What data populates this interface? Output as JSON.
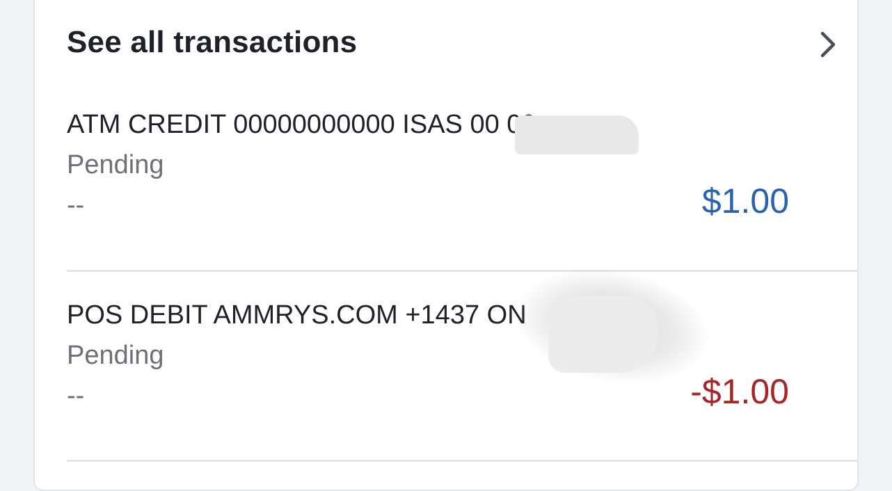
{
  "header": {
    "title": "See all transactions",
    "chevron_icon": "chevron-right-icon"
  },
  "transactions": [
    {
      "description": "ATM CREDIT 00000000000 ISAS 00 00",
      "status": "Pending",
      "date": "--",
      "amount": "$1.00",
      "amount_color": "#2a62b2"
    },
    {
      "description": "POS DEBIT AMMRYS.COM +1437 ON",
      "status": "Pending",
      "date": "--",
      "amount": "-$1.00",
      "amount_color": "#a82427"
    }
  ],
  "colors": {
    "background": "#f2f3f5",
    "card": "#ffffff",
    "primary_text": "#1e2228",
    "secondary_text": "#6d7075",
    "divider": "#e3e4e8"
  }
}
